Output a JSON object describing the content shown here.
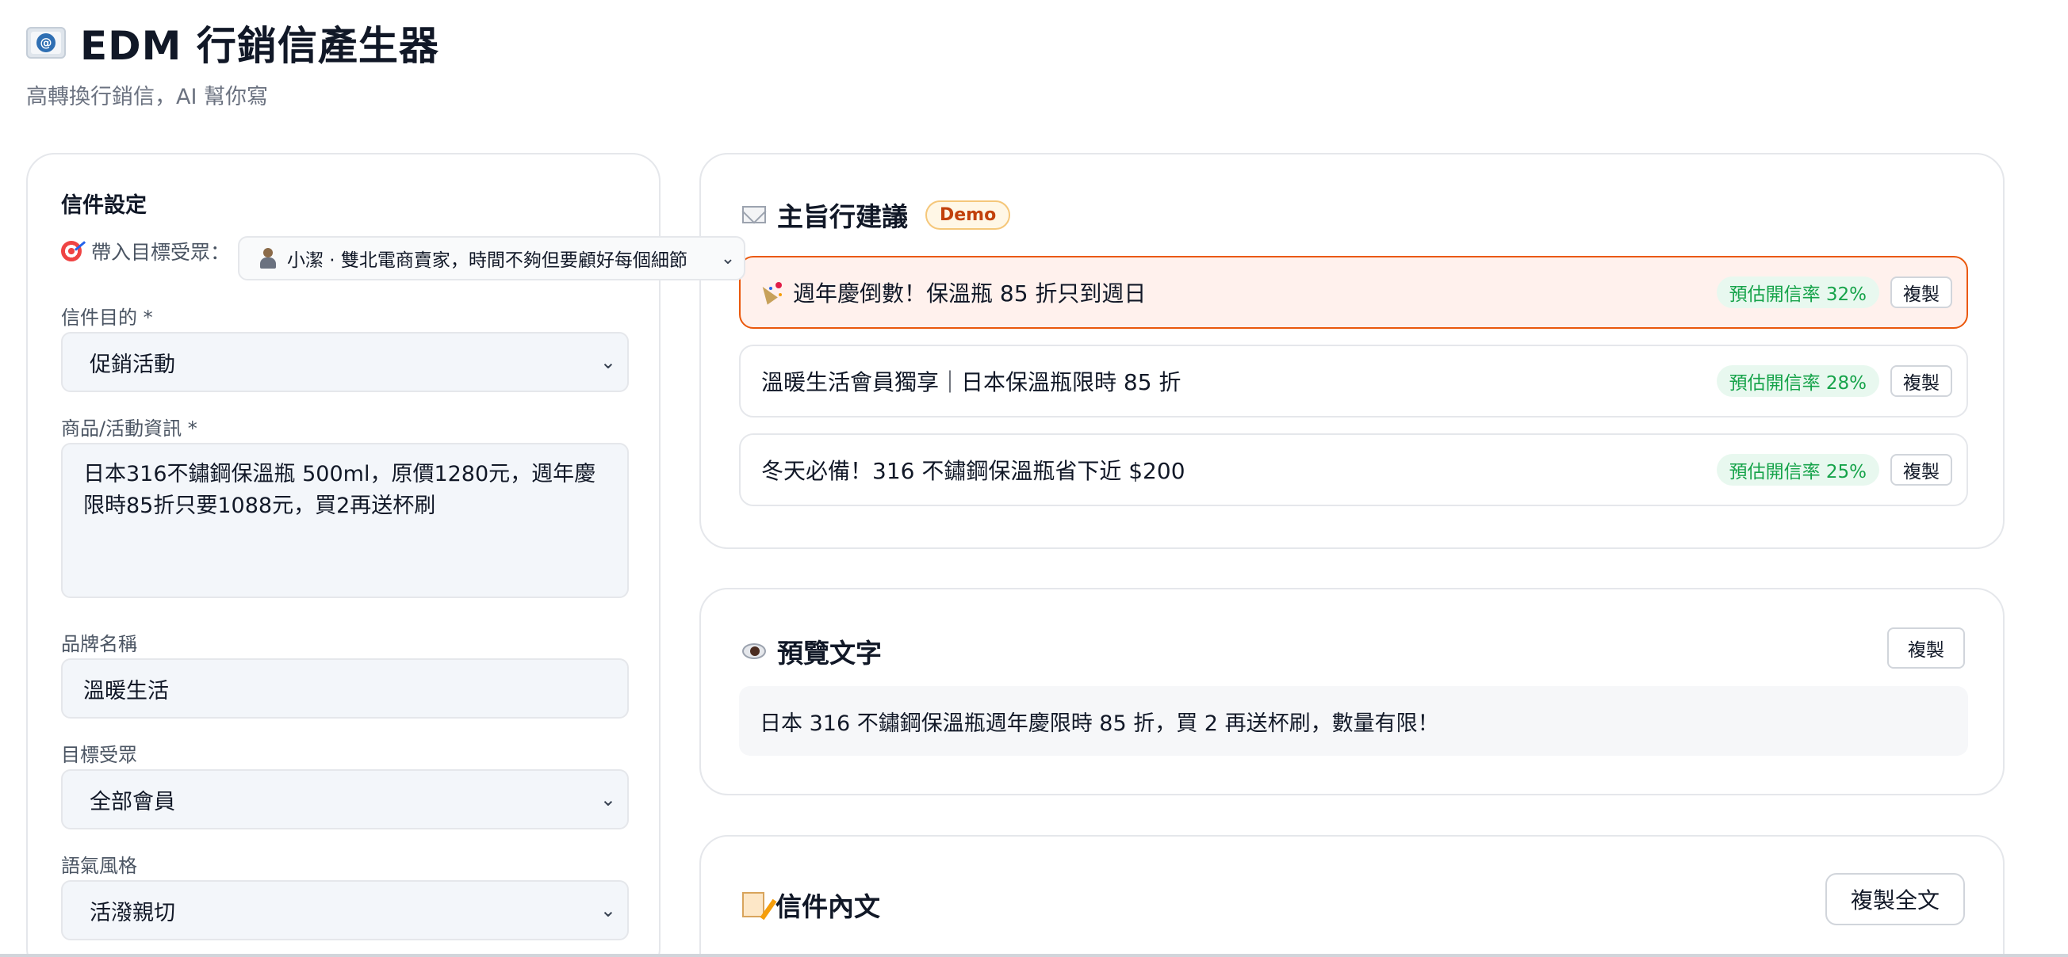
{
  "header": {
    "icon": "email-icon",
    "title": "EDM 行銷信產生器",
    "subtitle": "高轉換行銷信，AI 幫你寫"
  },
  "settings": {
    "panel_title": "信件設定",
    "persona_label": "帶入目標受眾：",
    "persona_value": "小潔 · 雙北電商賣家，時間不夠但要顧好每個細節",
    "purpose_label": "信件目的 *",
    "purpose_value": "促銷活動",
    "product_label": "商品/活動資訊 *",
    "product_value": "日本316不鏽鋼保溫瓶 500ml，原價1280元，週年慶限時85折只要1088元，買2再送杯刷",
    "brand_label": "品牌名稱",
    "brand_value": "溫暖生活",
    "audience_label": "目標受眾",
    "audience_value": "全部會員",
    "tone_label": "語氣風格",
    "tone_value": "活潑親切"
  },
  "subjects": {
    "title": "主旨行建議",
    "badge": "Demo",
    "items": [
      {
        "text": "週年慶倒數！保溫瓶 85 折只到週日",
        "rate": "預估開信率 32%",
        "copy": "複製",
        "icon": "party-popper-icon",
        "active": true
      },
      {
        "text": "溫暖生活會員獨享｜日本保溫瓶限時 85 折",
        "rate": "預估開信率 28%",
        "copy": "複製",
        "active": false
      },
      {
        "text": "冬天必備！316 不鏽鋼保溫瓶省下近 $200",
        "rate": "預估開信率 25%",
        "copy": "複製",
        "active": false
      }
    ]
  },
  "preview": {
    "title": "預覽文字",
    "copy": "複製",
    "text": "日本 316 不鏽鋼保溫瓶週年慶限時 85 折，買 2 再送杯刷，數量有限！"
  },
  "body": {
    "title": "信件內文",
    "copy_all": "複製全文"
  },
  "colors": {
    "accent": "#ea580c",
    "rate_green": "#16a34a",
    "demo_orange": "#c2410c"
  }
}
